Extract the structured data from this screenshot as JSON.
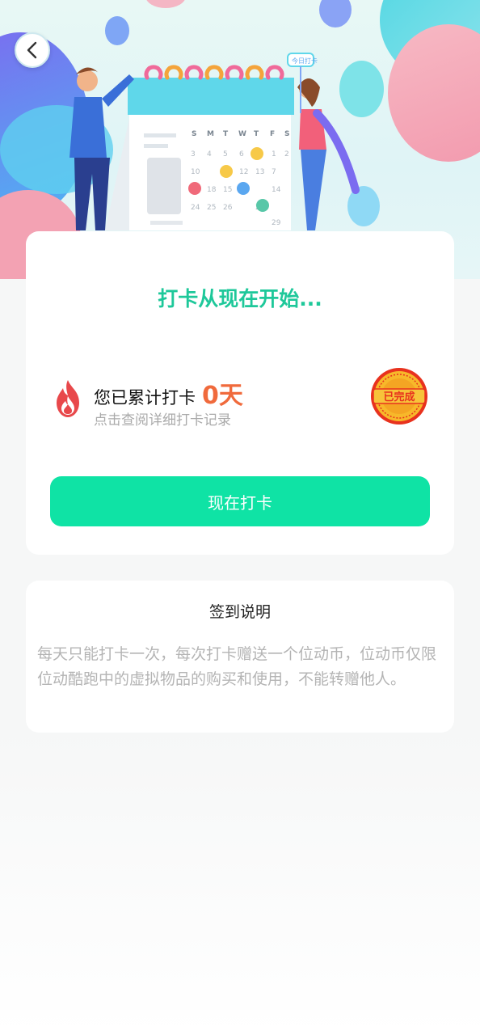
{
  "header": {
    "back_icon": "chevron-left-icon",
    "calendar_days": [
      "S",
      "M",
      "T",
      "W",
      "T",
      "F",
      "S"
    ],
    "sign_text": "今日打卡"
  },
  "checkin": {
    "title": "打卡从现在开始...",
    "count_label": "您已累计打卡",
    "days_value": "0天",
    "detail_hint": "点击查阅详细打卡记录",
    "badge_text": "已完成",
    "button_label": "现在打卡",
    "fire_icon": "fire-icon",
    "accent_color": "#1ec89a",
    "button_color": "#0fe3a5"
  },
  "rules": {
    "title": "签到说明",
    "text": "每天只能打卡一次，每次打卡赠送一个位动币，位动币仅限位动酷跑中的虚拟物品的购买和使用，不能转赠他人。"
  }
}
